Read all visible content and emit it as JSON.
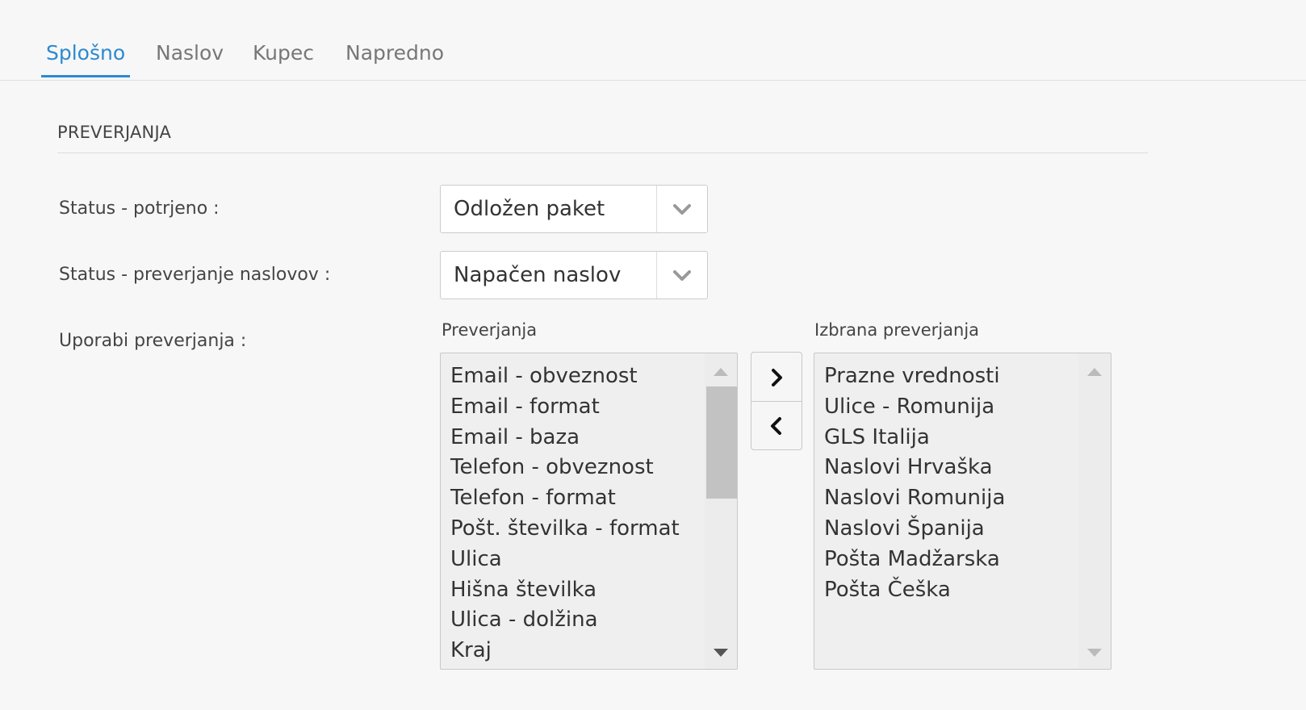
{
  "tabs": [
    {
      "label": "Splošno",
      "active": true
    },
    {
      "label": "Naslov",
      "active": false
    },
    {
      "label": "Kupec",
      "active": false
    },
    {
      "label": "Napredno",
      "active": false
    }
  ],
  "section": {
    "title": "PREVERJANJA"
  },
  "fields": {
    "status_confirmed": {
      "label": "Status - potrjeno :",
      "value": "Odložen paket"
    },
    "status_address_check": {
      "label": "Status - preverjanje naslovov :",
      "value": "Napačen naslov"
    },
    "use_checks": {
      "label": "Uporabi preverjanja :"
    }
  },
  "available": {
    "caption": "Preverjanja",
    "items": [
      "Email - obveznost",
      "Email - format",
      "Email - baza",
      "Telefon - obveznost",
      "Telefon - format",
      "Pošt. številka - format",
      "Ulica",
      "Hišna številka",
      "Ulica - dolžina",
      "Kraj"
    ]
  },
  "selected": {
    "caption": "Izbrana preverjanja",
    "items": [
      "Prazne vrednosti",
      "Ulice - Romunija",
      "GLS Italija",
      "Naslovi Hrvaška",
      "Naslovi Romunija",
      "Naslovi Španija",
      "Pošta Madžarska",
      "Pošta Češka"
    ]
  },
  "colors": {
    "accent": "#2b8ad1",
    "background": "#f7f7f7",
    "listbox": "#efefef"
  },
  "icons": {
    "dropdown": "chevron-down-icon",
    "move_right": "chevron-right-icon",
    "move_left": "chevron-left-icon",
    "scroll_up": "triangle-up-icon",
    "scroll_down": "triangle-down-icon"
  }
}
